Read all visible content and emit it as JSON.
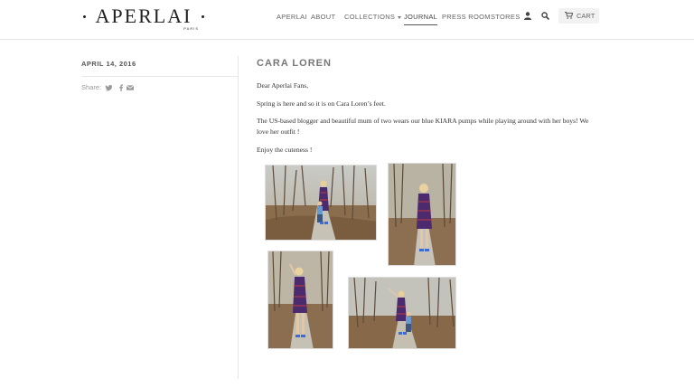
{
  "header": {
    "logo": "APERLAI",
    "logo_sub": "PARIS",
    "nav": [
      {
        "label": "APERLAI"
      },
      {
        "label": "ABOUT"
      },
      {
        "label": "COLLECTIONS"
      },
      {
        "label": "JOURNAL"
      },
      {
        "label": "PRESS ROOM"
      },
      {
        "label": "STORES"
      }
    ],
    "cart_label": "CART",
    "icons": {
      "account": "user-icon",
      "search": "search-icon",
      "cart": "cart-icon"
    }
  },
  "sidebar": {
    "date": "APRIL 14, 2016",
    "share_label": "Share:",
    "share_icons": [
      "twitter-icon",
      "facebook-icon",
      "email-icon"
    ]
  },
  "post": {
    "title": "CARA LOREN",
    "paragraphs": [
      "Dear Aperlai Fans,",
      "Spring is here and so it is on Cara Loren’s feet.",
      "The US-based blogger and beautiful mum of two wears our blue KIARA pumps while playing around with her boys! We love her outfit !",
      "Enjoy the cuteness !"
    ],
    "photos": [
      "photo-woman-with-child",
      "photo-woman-standing",
      "photo-woman-waving",
      "photo-woman-with-child-pointing"
    ]
  },
  "colors": {
    "text": "#333333",
    "nav_text": "#666666",
    "title": "#777777",
    "rule": "#e3e3e3",
    "dress_purple": "#4b2a6e"
  }
}
